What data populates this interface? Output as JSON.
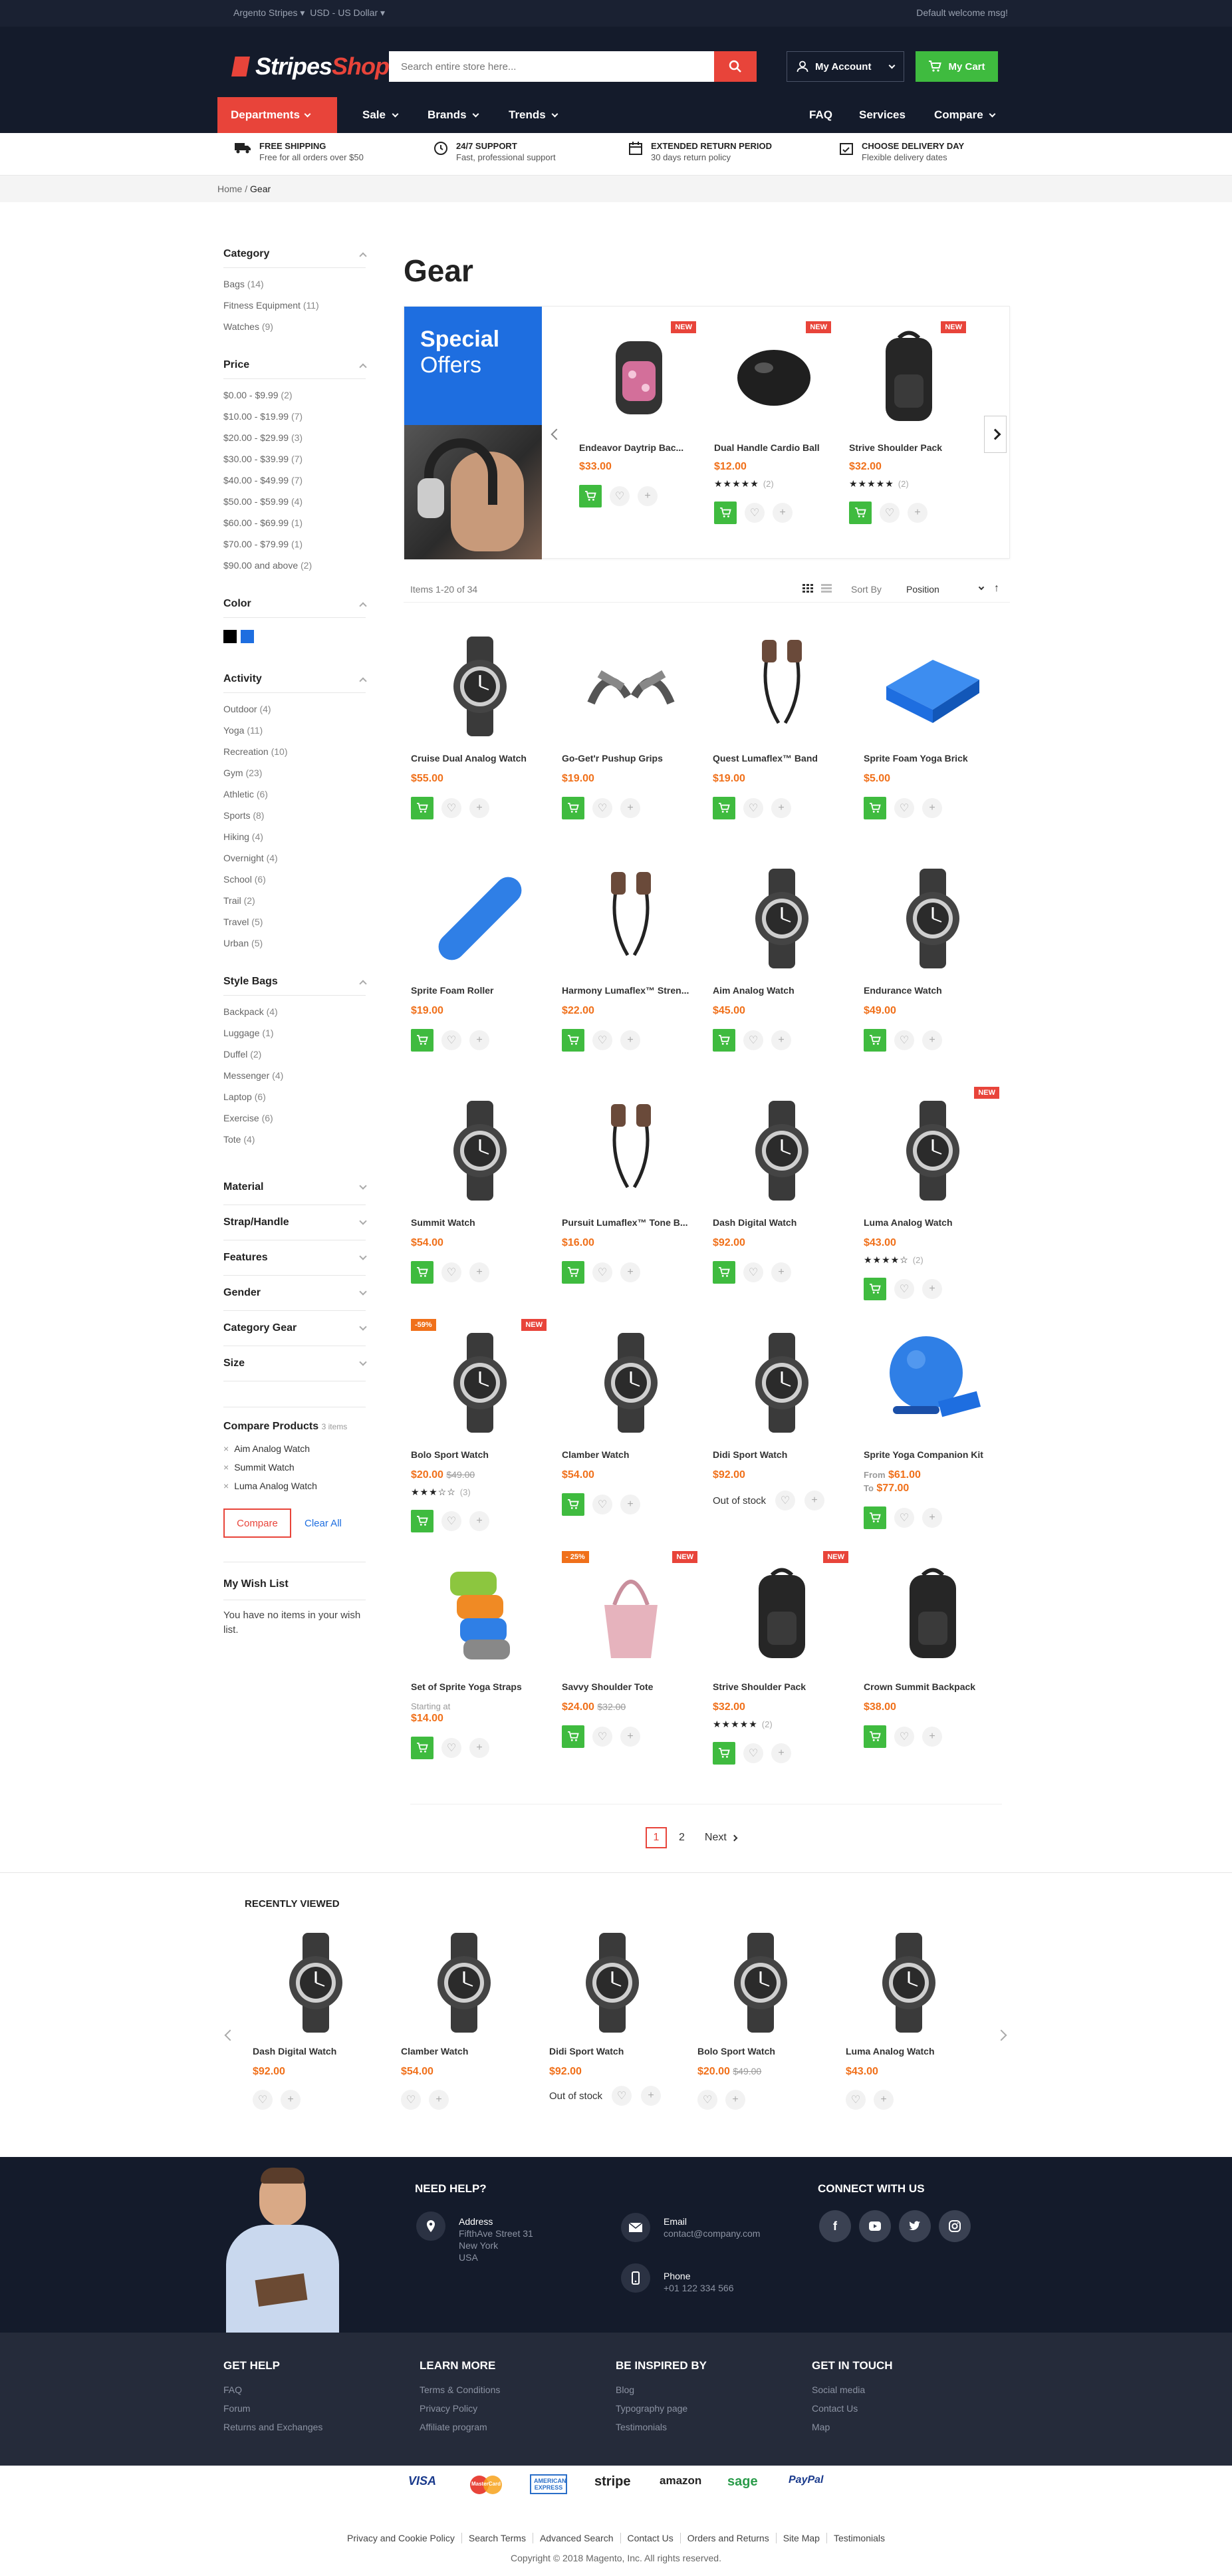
{
  "topbar": {
    "store": "Argento Stripes ▾",
    "currency": "USD - US Dollar ▾",
    "welcome": "Default welcome msg!"
  },
  "header": {
    "logo_a": "Stripes",
    "logo_b": "Shop",
    "search_placeholder": "Search entire store here...",
    "account_label": "My Account",
    "cart_label": "My Cart"
  },
  "nav": {
    "departments": "Departments",
    "sale": "Sale",
    "brands": "Brands",
    "trends": "Trends",
    "faq": "FAQ",
    "services": "Services",
    "compare": "Compare"
  },
  "features": [
    {
      "title": "Free Shipping",
      "sub": "Free for all orders over $50"
    },
    {
      "title": "24/7 Support",
      "sub": "Fast, professional support"
    },
    {
      "title": "Extended Return Period",
      "sub": "30 days return policy"
    },
    {
      "title": "Choose Delivery Day",
      "sub": "Flexible delivery dates"
    }
  ],
  "breadcrumb": {
    "home": "Home",
    "sep": "/",
    "current": "Gear"
  },
  "sidebar": {
    "category": {
      "title": "Category",
      "items": [
        [
          "Bags",
          "(14)"
        ],
        [
          "Fitness Equipment",
          "(11)"
        ],
        [
          "Watches",
          "(9)"
        ]
      ]
    },
    "price": {
      "title": "Price",
      "items": [
        [
          "$0.00 - $9.99",
          "(2)"
        ],
        [
          "$10.00 - $19.99",
          "(7)"
        ],
        [
          "$20.00 - $29.99",
          "(3)"
        ],
        [
          "$30.00 - $39.99",
          "(7)"
        ],
        [
          "$40.00 - $49.99",
          "(7)"
        ],
        [
          "$50.00 - $59.99",
          "(4)"
        ],
        [
          "$60.00 - $69.99",
          "(1)"
        ],
        [
          "$70.00 - $79.99",
          "(1)"
        ],
        [
          "$90.00 and above",
          "(2)"
        ]
      ]
    },
    "color": {
      "title": "Color",
      "swatches": [
        "#000000",
        "#1e6ee0"
      ]
    },
    "activity": {
      "title": "Activity",
      "items": [
        [
          "Outdoor",
          "(4)"
        ],
        [
          "Yoga",
          "(11)"
        ],
        [
          "Recreation",
          "(10)"
        ],
        [
          "Gym",
          "(23)"
        ],
        [
          "Athletic",
          "(6)"
        ],
        [
          "Sports",
          "(8)"
        ],
        [
          "Hiking",
          "(4)"
        ],
        [
          "Overnight",
          "(4)"
        ],
        [
          "School",
          "(6)"
        ],
        [
          "Trail",
          "(2)"
        ],
        [
          "Travel",
          "(5)"
        ],
        [
          "Urban",
          "(5)"
        ]
      ]
    },
    "style_bags": {
      "title": "Style Bags",
      "items": [
        [
          "Backpack",
          "(4)"
        ],
        [
          "Luggage",
          "(1)"
        ],
        [
          "Duffel",
          "(2)"
        ],
        [
          "Messenger",
          "(4)"
        ],
        [
          "Laptop",
          "(6)"
        ],
        [
          "Exercise",
          "(6)"
        ],
        [
          "Tote",
          "(4)"
        ]
      ]
    },
    "collapsed": [
      "Material",
      "Strap/Handle",
      "Features",
      "Gender",
      "Category Gear",
      "Size"
    ],
    "compare": {
      "title": "Compare Products",
      "count": "3 items",
      "items": [
        "Aim Analog Watch",
        "Summit Watch",
        "Luma Analog Watch"
      ],
      "compare_btn": "Compare",
      "clear": "Clear All"
    },
    "wishlist": {
      "title": "My Wish List",
      "empty": "You have no items in your wish list."
    }
  },
  "main": {
    "title": "Gear",
    "special": {
      "line1": "Special",
      "line2": "Offers",
      "badge": "NEW",
      "items": [
        {
          "name": "Endeavor Daytrip Bac...",
          "price": "$33.00",
          "stars": "",
          "count": ""
        },
        {
          "name": "Dual Handle Cardio Ball",
          "price": "$12.00",
          "stars": "★★★★★",
          "count": "(2)"
        },
        {
          "name": "Strive Shoulder Pack",
          "price": "$32.00",
          "stars": "★★★★★",
          "count": "(2)"
        }
      ]
    },
    "toolbar": {
      "items": "Items 1-20 of 34",
      "sort_by": "Sort By",
      "sort_value": "Position"
    },
    "products": [
      {
        "name": "Cruise Dual Analog Watch",
        "price": "$55.00",
        "icon": "watch"
      },
      {
        "name": "Go-Get'r Pushup Grips",
        "price": "$19.00",
        "icon": "grips"
      },
      {
        "name": "Quest Lumaflex™ Band",
        "price": "$19.00",
        "icon": "band"
      },
      {
        "name": "Sprite Foam Yoga Brick",
        "price": "$5.00",
        "icon": "brick"
      },
      {
        "name": "Sprite Foam Roller",
        "price": "$19.00",
        "icon": "roller"
      },
      {
        "name": "Harmony Lumaflex™ Stren...",
        "price": "$22.00",
        "icon": "band"
      },
      {
        "name": "Aim Analog Watch",
        "price": "$45.00",
        "icon": "watch"
      },
      {
        "name": "Endurance Watch",
        "price": "$49.00",
        "icon": "watch"
      },
      {
        "name": "Summit Watch",
        "price": "$54.00",
        "icon": "watch"
      },
      {
        "name": "Pursuit Lumaflex™ Tone B...",
        "price": "$16.00",
        "icon": "band"
      },
      {
        "name": "Dash Digital Watch",
        "price": "$92.00",
        "icon": "watch"
      },
      {
        "name": "Luma Analog Watch",
        "price": "$43.00",
        "icon": "watch",
        "badge": "NEW",
        "stars": "★★★★☆",
        "count": "(2)"
      },
      {
        "name": "Bolo Sport Watch",
        "price": "$20.00",
        "old": "$49.00",
        "icon": "watch",
        "sale": "-59%",
        "badge": "NEW",
        "stars": "★★★☆☆",
        "count": "(3)"
      },
      {
        "name": "Clamber Watch",
        "price": "$54.00",
        "icon": "watch"
      },
      {
        "name": "Didi Sport Watch",
        "price": "$92.00",
        "icon": "watch",
        "oos": "Out of stock"
      },
      {
        "name": "Sprite Yoga Companion Kit",
        "from": "From",
        "price": "$61.00",
        "to": "To",
        "price2": "$77.00",
        "icon": "ball"
      },
      {
        "name": "Set of Sprite Yoga Straps",
        "starting": "Starting at",
        "price": "$14.00",
        "icon": "straps"
      },
      {
        "name": "Savvy Shoulder Tote",
        "price": "$24.00",
        "old": "$32.00",
        "icon": "tote",
        "sale": "- 25%",
        "badge": "NEW"
      },
      {
        "name": "Strive Shoulder Pack",
        "price": "$32.00",
        "icon": "pack",
        "badge": "NEW",
        "stars": "★★★★★",
        "count": "(2)"
      },
      {
        "name": "Crown Summit Backpack",
        "price": "$38.00",
        "icon": "pack"
      }
    ],
    "pager": {
      "p1": "1",
      "p2": "2",
      "next": "Next"
    }
  },
  "recent": {
    "title": "RECENTLY VIEWED",
    "items": [
      {
        "name": "Dash Digital Watch",
        "price": "$92.00"
      },
      {
        "name": "Clamber Watch",
        "price": "$54.00"
      },
      {
        "name": "Didi Sport Watch",
        "price": "$92.00",
        "oos": "Out of stock"
      },
      {
        "name": "Bolo Sport Watch",
        "price": "$20.00",
        "old": "$49.00"
      },
      {
        "name": "Luma Analog Watch",
        "price": "$43.00"
      }
    ]
  },
  "footer": {
    "need_help": "NEED HELP?",
    "address_label": "Address",
    "address": [
      "FifthAve Street 31",
      "New York",
      "USA"
    ],
    "email_label": "Email",
    "email": "contact@company.com",
    "phone_label": "Phone",
    "phone": "+01 122 334 566",
    "connect": "CONNECT WITH US",
    "cols": [
      {
        "title": "GET HELP",
        "links": [
          "FAQ",
          "Forum",
          "Returns and Exchanges"
        ]
      },
      {
        "title": "LEARN MORE",
        "links": [
          "Terms & Conditions",
          "Privacy Policy",
          "Affiliate program"
        ]
      },
      {
        "title": "BE INSPIRED BY",
        "links": [
          "Blog",
          "Typography page",
          "Testimonials"
        ]
      },
      {
        "title": "GET IN TOUCH",
        "links": [
          "Social media",
          "Contact Us",
          "Map"
        ]
      }
    ],
    "payments": [
      "VISA",
      "MasterCard",
      "AMERICAN EXPRESS",
      "stripe",
      "amazon",
      "sage",
      "PayPal"
    ],
    "links": [
      "Privacy and Cookie Policy",
      "Search Terms",
      "Advanced Search",
      "Contact Us",
      "Orders and Returns",
      "Site Map",
      "Testimonials"
    ],
    "copyright": "Copyright © 2018 Magento, Inc. All rights reserved."
  }
}
